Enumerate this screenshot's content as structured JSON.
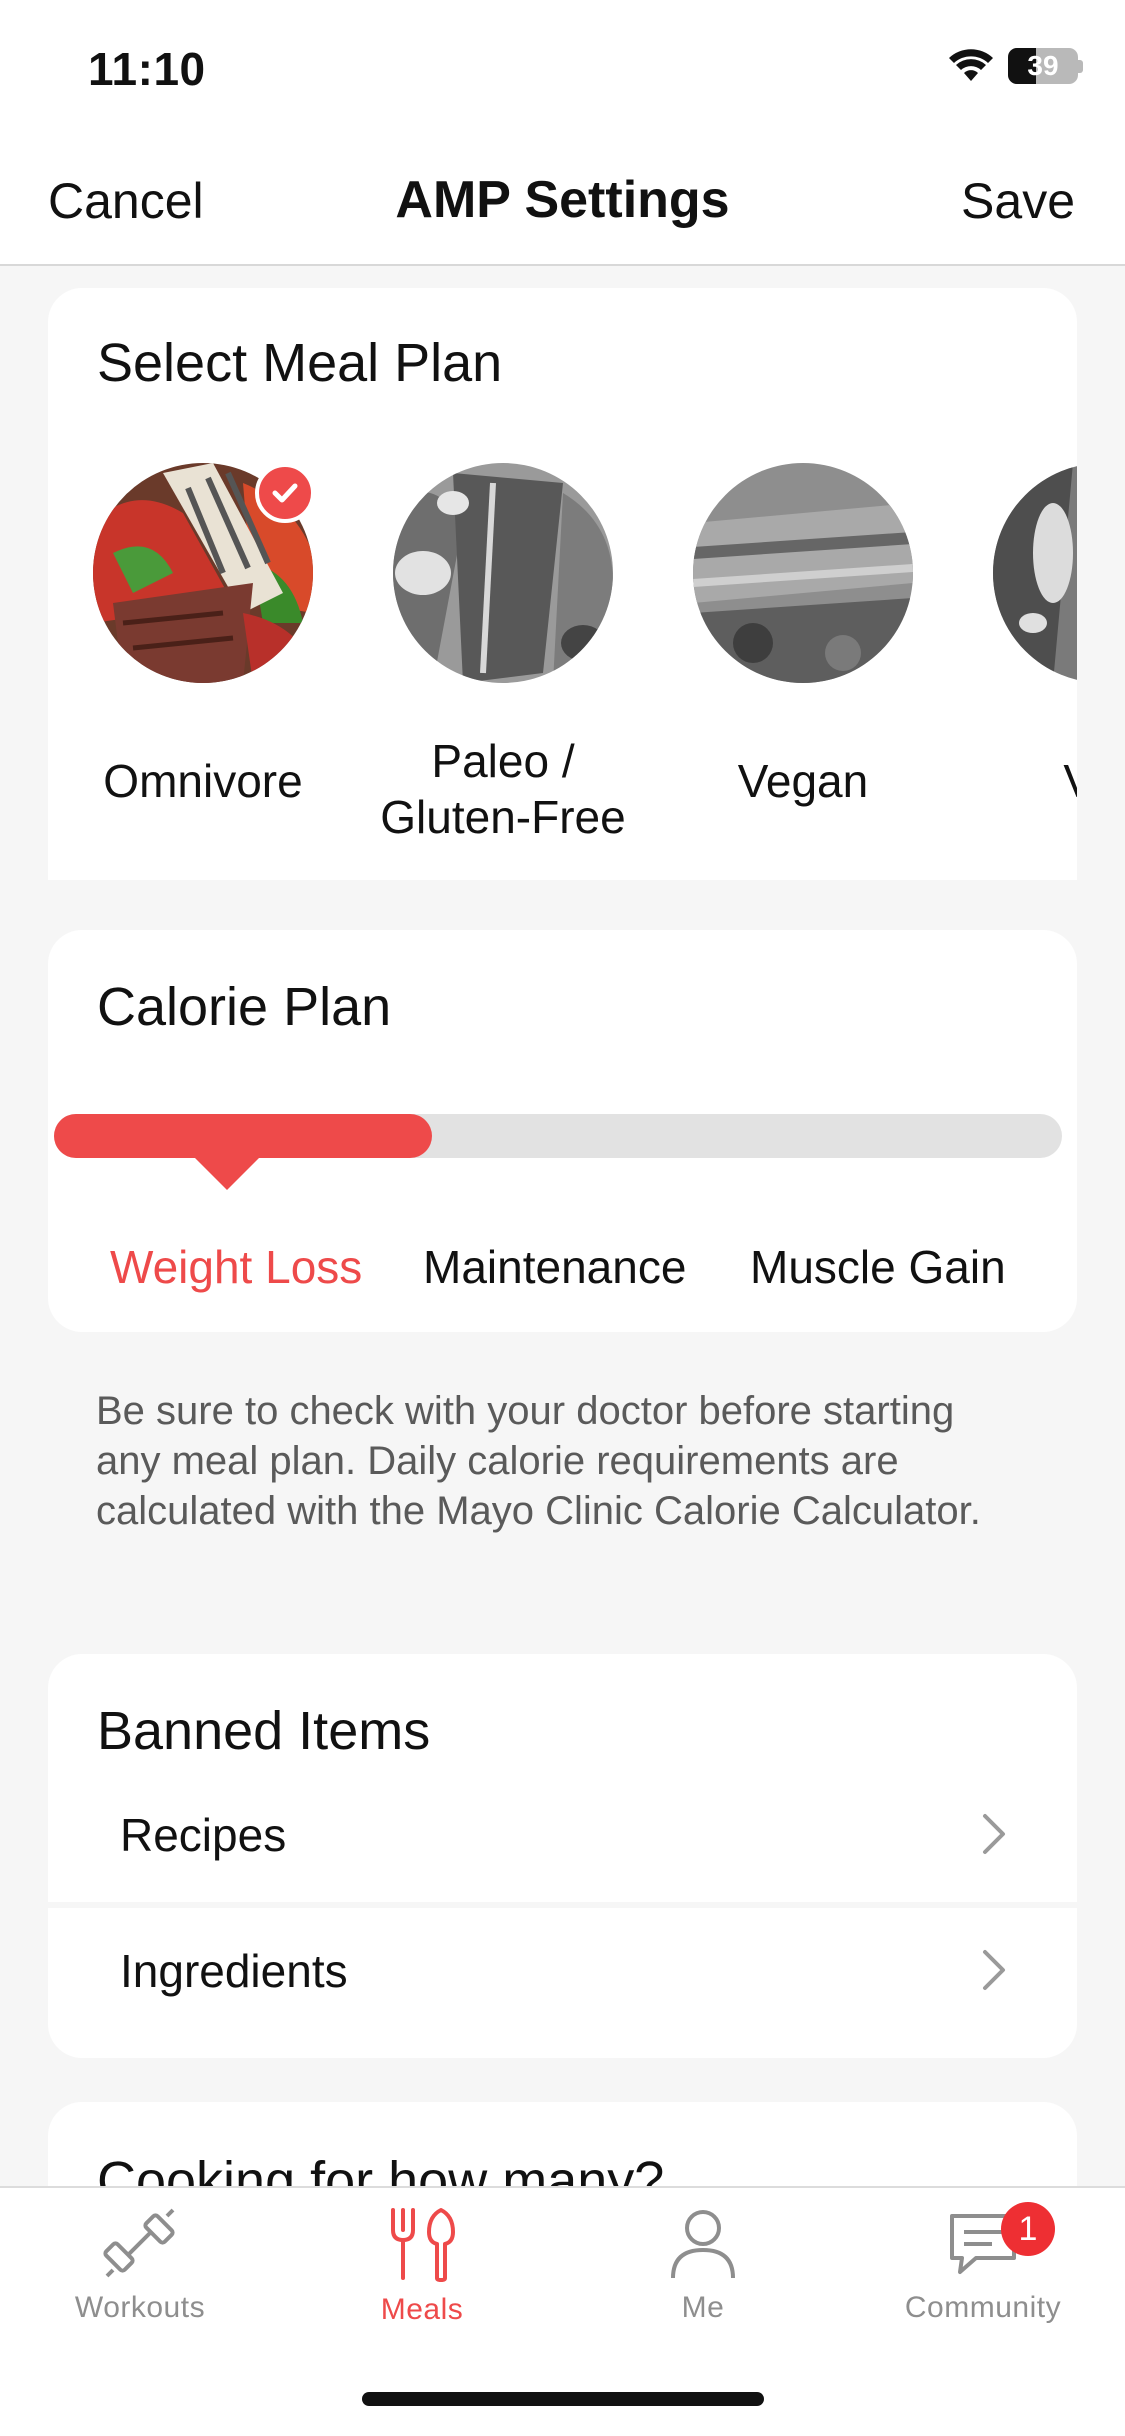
{
  "status_bar": {
    "time": "11:10",
    "battery": "39"
  },
  "nav": {
    "cancel": "Cancel",
    "title": "AMP Settings",
    "save": "Save"
  },
  "meal_plan": {
    "title": "Select Meal Plan",
    "options": [
      {
        "label": "Omnivore",
        "selected": true
      },
      {
        "label": "Paleo / Gluten-Free",
        "selected": false
      },
      {
        "label": "Vegan",
        "selected": false
      },
      {
        "label": "Veg",
        "selected": false
      }
    ]
  },
  "calorie_plan": {
    "title": "Calorie Plan",
    "options": [
      "Weight Loss",
      "Maintenance",
      "Muscle Gain"
    ],
    "selected": "Weight Loss",
    "accent": "#ee4a4a"
  },
  "disclaimer": "Be sure to check with your doctor before starting any meal plan. Daily calorie requirements are calculated with the Mayo Clinic Calorie Calculator.",
  "banned": {
    "title": "Banned Items",
    "rows": [
      "Recipes",
      "Ingredients"
    ]
  },
  "cooking": {
    "title": "Cooking for how many?"
  },
  "tabs": [
    {
      "label": "Workouts",
      "icon": "dumbbell-icon",
      "active": false
    },
    {
      "label": "Meals",
      "icon": "fork-knife-icon",
      "active": true
    },
    {
      "label": "Me",
      "icon": "person-icon",
      "active": false
    },
    {
      "label": "Community",
      "icon": "chat-icon",
      "active": false,
      "badge": "1"
    }
  ]
}
